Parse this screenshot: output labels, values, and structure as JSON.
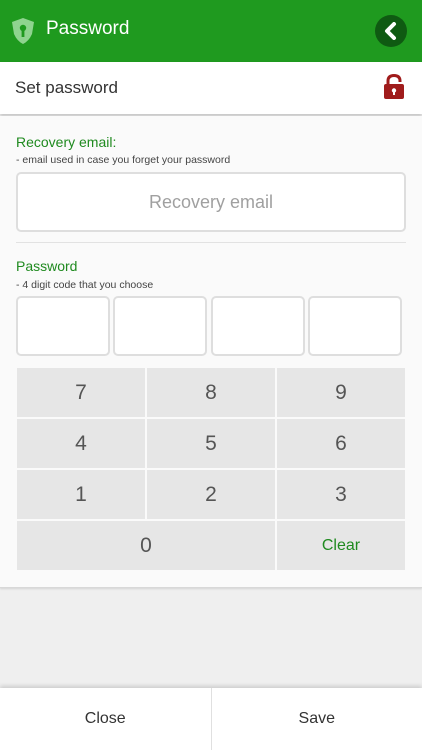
{
  "header": {
    "title": "Password",
    "app_icon": "shield-icon",
    "back_icon": "chevron-left-icon",
    "color": "#1f9a1f"
  },
  "subheader": {
    "title": "Set password",
    "lock_icon": "lock-icon",
    "lock_color": "#a01c1c"
  },
  "recovery": {
    "label": "Recovery email:",
    "hint": "- email used in case you forget your password",
    "value": "",
    "placeholder": "Recovery email"
  },
  "password": {
    "label": "Password",
    "hint": "- 4 digit code that you choose",
    "digits": [
      "",
      "",
      "",
      ""
    ]
  },
  "keypad": {
    "keys": [
      "7",
      "8",
      "9",
      "4",
      "5",
      "6",
      "1",
      "2",
      "3"
    ],
    "zero": "0",
    "clear": "Clear"
  },
  "footer": {
    "close_label": "Close",
    "save_label": "Save"
  }
}
